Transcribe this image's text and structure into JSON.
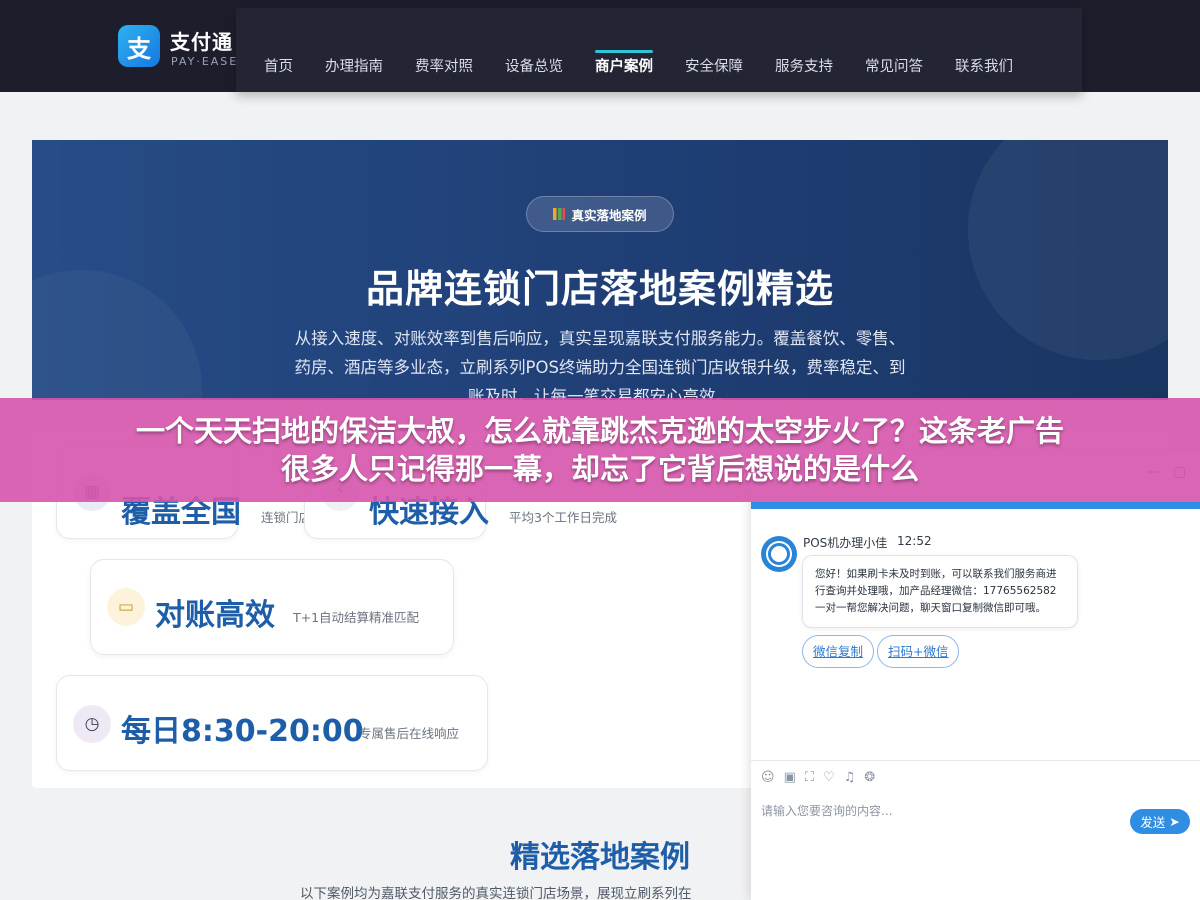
{
  "brand": {
    "logo_char": "支",
    "name": "支付通",
    "sub": "PAY·EASE"
  },
  "nav": [
    {
      "label": "首页"
    },
    {
      "label": "办理指南"
    },
    {
      "label": "费率对照"
    },
    {
      "label": "设备总览"
    },
    {
      "label": "商户案例",
      "active": true
    },
    {
      "label": "安全保障"
    },
    {
      "label": "服务支持"
    },
    {
      "label": "常见问答"
    },
    {
      "label": "联系我们"
    }
  ],
  "hero": {
    "badge": "真实落地案例",
    "title": "品牌连锁门店落地案例精选",
    "desc": "从接入速度、对账效率到售后响应，真实呈现嘉联支付服务能力。覆盖餐饮、零售、药房、酒店等多业态，立刷系列POS终端助力全国连锁门店收银升级，费率稳定、到账及时，让每一笔交易都安心高效。"
  },
  "features": [
    {
      "big": "覆盖全国",
      "small": "连锁门店"
    },
    {
      "big": "快速接入",
      "small": "平均3个工作日完成"
    },
    {
      "big": "对账高效",
      "small": "T+1自动结算精准匹配"
    },
    {
      "big": "每日8:30-20:00",
      "small": "专属售后在线响应"
    }
  ],
  "section": {
    "title": "精选落地案例",
    "desc": "以下案例均为嘉联支付服务的真实连锁门店场景，展现立刷系列在"
  },
  "chat": {
    "agent": "POS机办理小佳",
    "time": "12:52",
    "message": "您好！如果刷卡未及时到账，可以联系我们服务商进行查询并处理哦，加产品经理微信：17765562582 一对一帮您解决问题，聊天窗口复制微信即可哦。",
    "chips": [
      "微信复制",
      "扫码+微信"
    ],
    "placeholder": "请输入您要咨询的内容...",
    "send": "发送"
  },
  "banner": {
    "line1": "一个天天扫地的保洁大叔，怎么就靠跳杰克逊的太空步火了？这条老广告",
    "line2": "很多人只记得那一幕，却忘了它背后想说的是什么"
  }
}
